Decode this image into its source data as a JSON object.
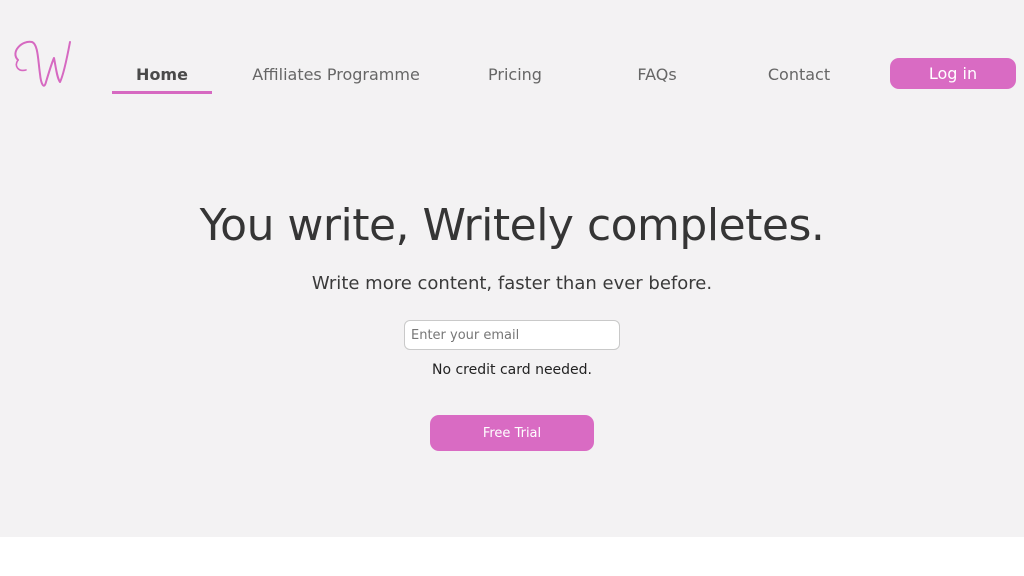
{
  "brand": {
    "accent": "#d96bc3",
    "logo_icon": "script-w-logo"
  },
  "nav": {
    "items": [
      {
        "label": "Home",
        "active": true
      },
      {
        "label": "Affiliates Programme"
      },
      {
        "label": "Pricing"
      },
      {
        "label": "FAQs"
      },
      {
        "label": "Contact"
      }
    ],
    "login_label": "Log in"
  },
  "hero": {
    "headline": "You write, Writely completes.",
    "subline": "Write more content, faster than ever before.",
    "email_placeholder": "Enter your email",
    "email_value": "",
    "note": "No credit card needed.",
    "cta_label": "Free Trial"
  }
}
